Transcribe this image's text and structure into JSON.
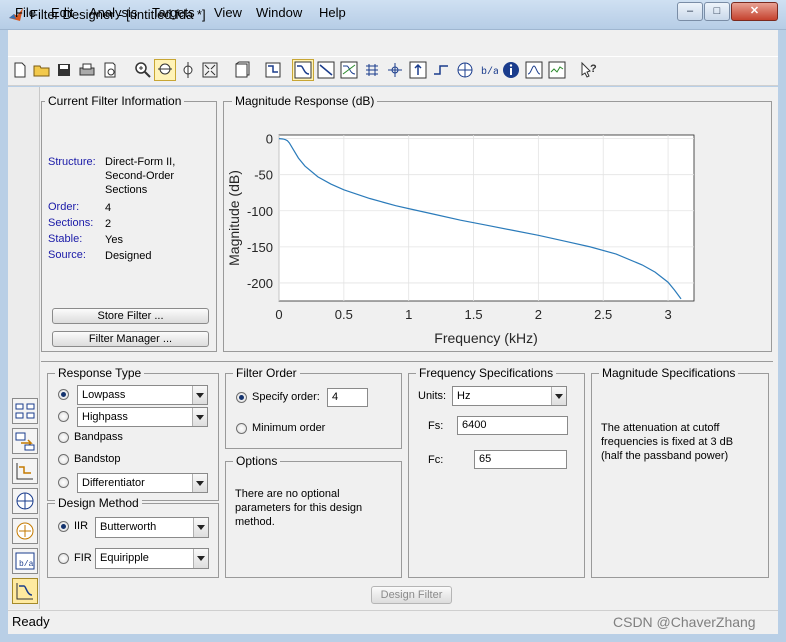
{
  "window": {
    "title": "Filter Designer -  [untitled.fda *]",
    "minimize": "–",
    "maximize": "□",
    "close": "✕"
  },
  "menu": [
    "File",
    "Edit",
    "Analysis",
    "Targets",
    "View",
    "Window",
    "Help"
  ],
  "toolbar_icons": [
    "new-file-icon",
    "open-folder-icon",
    "save-icon",
    "print-icon",
    "print-preview-icon",
    "zoom-in-icon",
    "zoom-x-icon",
    "zoom-y-icon",
    "full-view-icon",
    "new-figure-icon",
    "filter-specs-icon",
    "magnitude-response-icon",
    "phase-response-icon",
    "magnitude-phase-icon",
    "group-delay-icon",
    "phase-delay-icon",
    "impulse-response-icon",
    "step-response-icon",
    "pole-zero-icon",
    "coefficients-icon",
    "info-icon",
    "cost-icon",
    "round-off-icon",
    "whats-this-icon"
  ],
  "current_filter": {
    "title": "Current Filter Information",
    "rows": [
      {
        "key": "Structure:",
        "value": "Direct-Form II,\nSecond-Order\nSections"
      },
      {
        "key": "Order:",
        "value": "4"
      },
      {
        "key": "Sections:",
        "value": "2"
      },
      {
        "key": "Stable:",
        "value": "Yes"
      },
      {
        "key": "Source:",
        "value": "Designed"
      }
    ],
    "store_button": "Store Filter ...",
    "manager_button": "Filter Manager ..."
  },
  "plot_panel": {
    "title": "Magnitude Response (dB)"
  },
  "chart_data": {
    "type": "line",
    "title": "",
    "xlabel": "Frequency (kHz)",
    "ylabel": "Magnitude (dB)",
    "xlim": [
      0,
      3.2
    ],
    "ylim": [
      -225,
      5
    ],
    "xticks": [
      0,
      0.5,
      1,
      1.5,
      2,
      2.5,
      3
    ],
    "xtick_labels": [
      "0",
      "0.5",
      "1",
      "1.5",
      "2",
      "2.5",
      "3"
    ],
    "yticks": [
      0,
      -50,
      -100,
      -150,
      -200
    ],
    "ytick_labels": [
      "0",
      "-50",
      "-100",
      "-150",
      "-200"
    ],
    "grid": true,
    "line_color": "#2b7bba",
    "series": [
      {
        "x": [
          0,
          0.03,
          0.05,
          0.065,
          0.08,
          0.1,
          0.15,
          0.2,
          0.3,
          0.4,
          0.5,
          0.6,
          0.7,
          0.8,
          0.9,
          1.0,
          1.2,
          1.4,
          1.6,
          1.8,
          2.0,
          2.2,
          2.4,
          2.6,
          2.8,
          2.9,
          3.0,
          3.05,
          3.1
        ],
        "y": [
          0,
          -0.5,
          -1.5,
          -3,
          -6,
          -12,
          -27,
          -38,
          -53,
          -63,
          -71,
          -77,
          -83,
          -88,
          -93,
          -97,
          -105,
          -113,
          -120,
          -127,
          -134,
          -142,
          -150,
          -160,
          -175,
          -185,
          -199,
          -210,
          -222
        ]
      }
    ]
  },
  "response_type": {
    "title": "Response Type",
    "options": [
      "Lowpass",
      "Highpass",
      "Bandpass",
      "Bandstop",
      "Differentiator"
    ],
    "lowpass_select": "Lowpass",
    "highpass_select": "Highpass",
    "other_select": "Differentiator"
  },
  "design_method": {
    "title": "Design Method",
    "iir_label": "IIR",
    "iir_select": "Butterworth",
    "fir_label": "FIR",
    "fir_select": "Equiripple"
  },
  "filter_order": {
    "title": "Filter Order",
    "specify_label": "Specify order:",
    "specify_value": "4",
    "minimum_label": "Minimum order"
  },
  "options": {
    "title": "Options",
    "text": "There are no optional\nparameters for this design\nmethod."
  },
  "freq_specs": {
    "title": "Frequency Specifications",
    "units_label": "Units:",
    "units_value": "Hz",
    "fs_label": "Fs:",
    "fs_value": "6400",
    "fc_label": "Fc:",
    "fc_value": "65"
  },
  "mag_specs": {
    "title": "Magnitude Specifications",
    "text": "The attenuation at cutoff\nfrequencies is fixed at 3 dB\n(half the passband power)"
  },
  "design_button": "Design Filter",
  "status": "Ready",
  "watermark": "CSDN @ChaverZhang"
}
